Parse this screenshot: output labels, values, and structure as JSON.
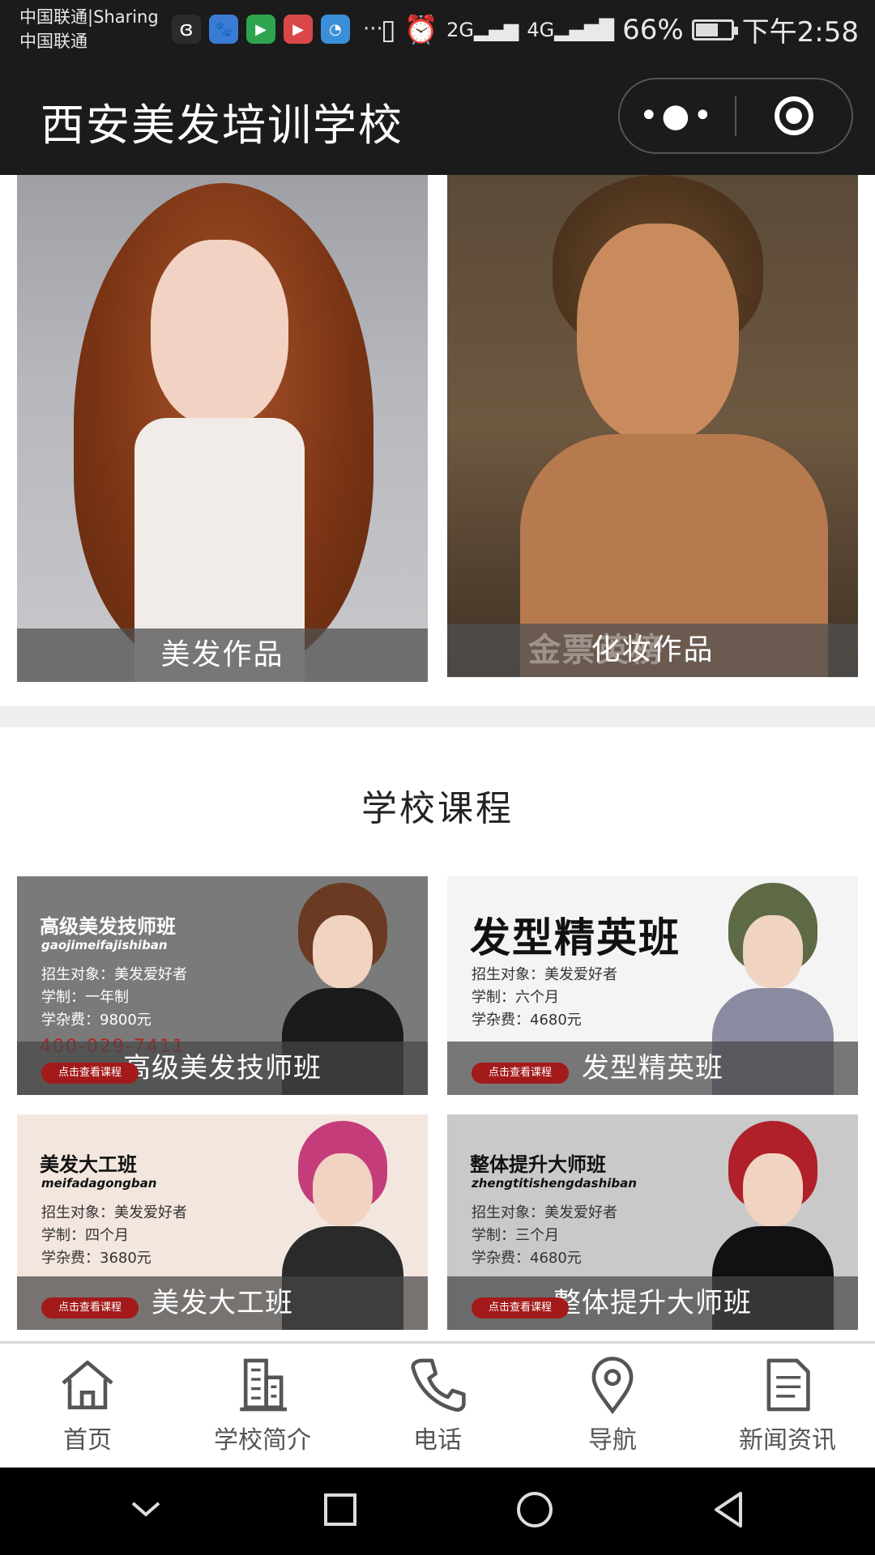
{
  "status_bar": {
    "carrier_line1": "中国联通|Sharing",
    "carrier_line2": "中国联通",
    "network_2g": "2G",
    "network_4g": "4G",
    "battery_percent": "66%",
    "battery_level": 0.66,
    "time": "下午2:58",
    "overflow": "···"
  },
  "header": {
    "title": "西安美发培训学校"
  },
  "works": [
    {
      "caption": "美发作品"
    },
    {
      "caption": "化妆作品",
      "watermark": "金票英榜"
    }
  ],
  "courses_section": {
    "title": "学校课程"
  },
  "courses": [
    {
      "banner_title": "高级美发技师班",
      "pinyin": "gaojimeifajishiban",
      "target": "招生对象：美发爱好者",
      "duration": "学制：一年制",
      "fee": "学杂费：9800元",
      "phone": "400-029-7411",
      "button": "点击查看课程",
      "caption": "高级美发技师班"
    },
    {
      "banner_title": "发型精英班",
      "target": "招生对象：美发爱好者",
      "duration": "学制：六个月",
      "fee": "学杂费：4680元",
      "button": "点击查看课程",
      "caption": "发型精英班"
    },
    {
      "banner_title": "美发大工班",
      "pinyin": "meifadagongban",
      "target": "招生对象：美发爱好者",
      "duration": "学制：四个月",
      "fee": "学杂费：3680元",
      "button": "点击查看课程",
      "caption": "美发大工班"
    },
    {
      "banner_title": "整体提升大师班",
      "pinyin": "zhengtitishengdashiban",
      "target": "招生对象：美发爱好者",
      "duration": "学制：三个月",
      "fee": "学杂费：4680元",
      "button": "点击查看课程",
      "caption": "整体提升大师班"
    }
  ],
  "tabbar": {
    "items": [
      {
        "label": "首页",
        "icon": "home-icon"
      },
      {
        "label": "学校简介",
        "icon": "building-icon"
      },
      {
        "label": "电话",
        "icon": "phone-icon"
      },
      {
        "label": "导航",
        "icon": "location-pin-icon"
      },
      {
        "label": "新闻资讯",
        "icon": "document-icon"
      }
    ]
  },
  "colors": {
    "header_bg": "#1b1b1b",
    "caption_overlay": "#505050",
    "button_red": "#a31a1a",
    "tab_gray": "#555555"
  }
}
